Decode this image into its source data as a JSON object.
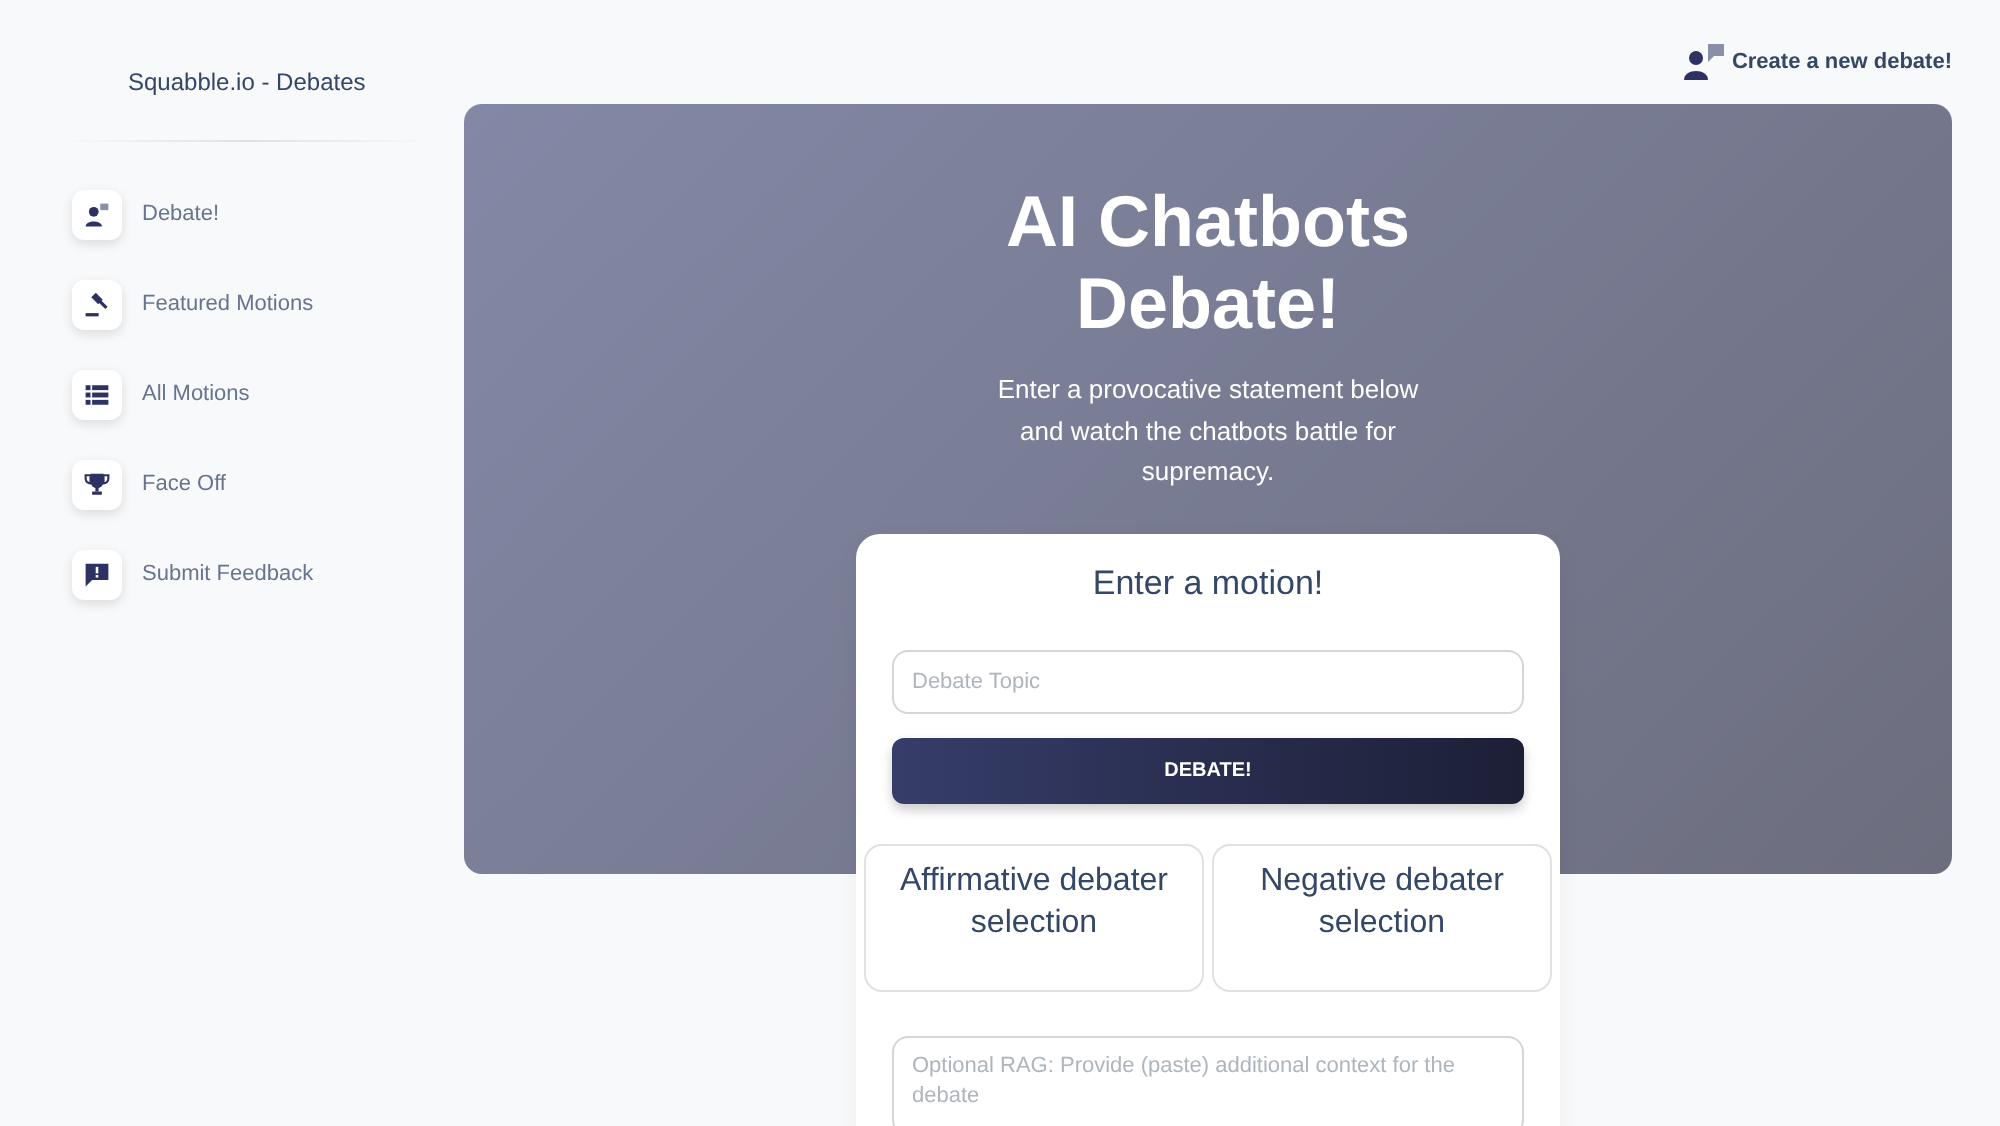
{
  "brand": "Squabble.io - Debates",
  "sidebar": {
    "items": [
      {
        "label": "Debate!"
      },
      {
        "label": "Featured Motions"
      },
      {
        "label": "All Motions"
      },
      {
        "label": "Face Off"
      },
      {
        "label": "Submit Feedback"
      }
    ]
  },
  "header": {
    "create_link": "Create a new debate!"
  },
  "hero": {
    "title": "AI Chatbots Debate!",
    "subtitle": "Enter a provocative statement below and watch the chatbots battle for supremacy."
  },
  "motion_card": {
    "title": "Enter a motion!",
    "topic_field": {
      "placeholder": "Debate Topic"
    },
    "button": "DEBATE!",
    "selections": [
      {
        "label": "Affirmative debater selection"
      },
      {
        "label": "Negative debater selection"
      }
    ],
    "context_field": {
      "placeholder": "Optional RAG: Provide (paste) additional context for the debate"
    }
  }
}
